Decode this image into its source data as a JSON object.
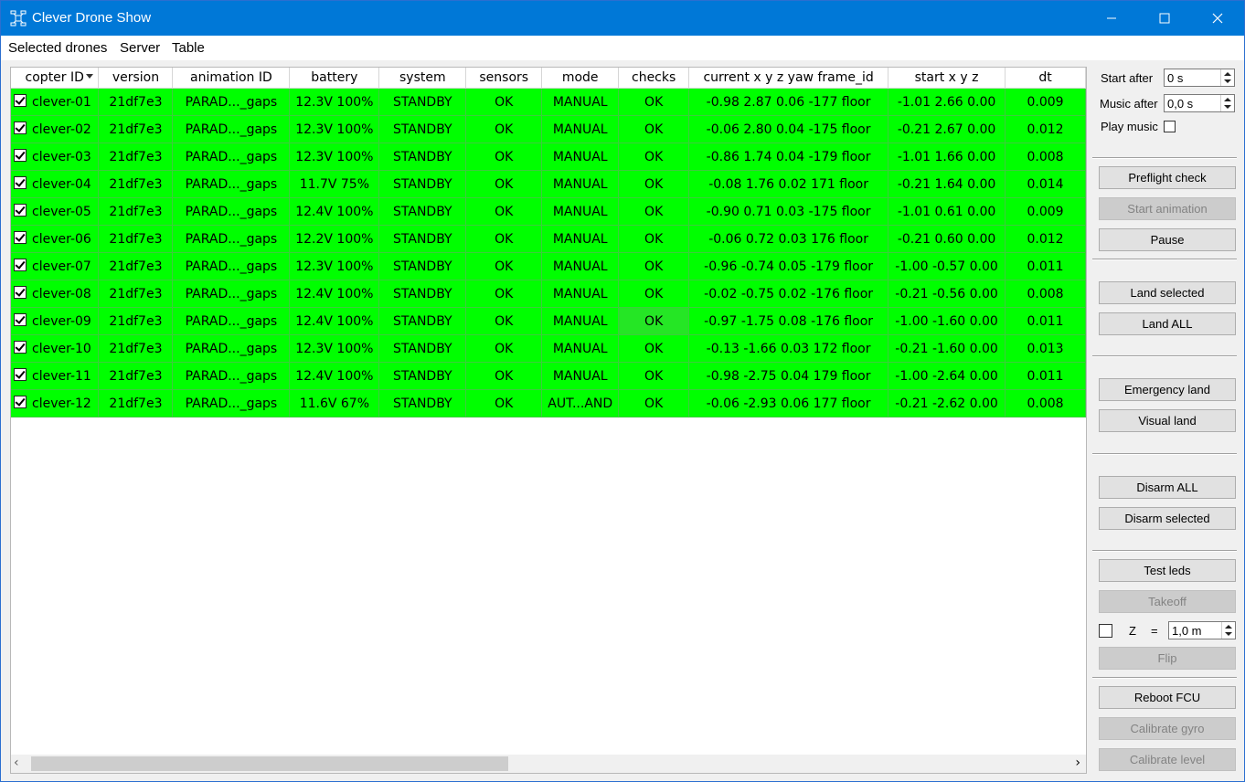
{
  "window": {
    "title": "Clever Drone Show",
    "minimize_icon": "minimize-icon",
    "maximize_icon": "maximize-icon",
    "close_icon": "close-icon"
  },
  "menu": {
    "items": [
      "Selected drones",
      "Server",
      "Table"
    ]
  },
  "table": {
    "columns": [
      "copter ID",
      "version",
      "animation ID",
      "battery",
      "system",
      "sensors",
      "mode",
      "checks",
      "current x y z yaw frame_id",
      "start x y z",
      "dt"
    ],
    "sort_column": "copter ID",
    "row_color": "#00ff00",
    "rows": [
      {
        "checked": true,
        "id": "clever-01",
        "version": "21df7e3",
        "animation": "PARAD..._gaps",
        "battery": "12.3V 100%",
        "system": "STANDBY",
        "sensors": "OK",
        "mode": "MANUAL",
        "checks": "OK",
        "current": "-0.98 2.87 0.06 -177 floor",
        "start": "-1.01 2.66 0.00",
        "dt": "0.009"
      },
      {
        "checked": true,
        "id": "clever-02",
        "version": "21df7e3",
        "animation": "PARAD..._gaps",
        "battery": "12.3V 100%",
        "system": "STANDBY",
        "sensors": "OK",
        "mode": "MANUAL",
        "checks": "OK",
        "current": "-0.06 2.80 0.04 -175 floor",
        "start": "-0.21 2.67 0.00",
        "dt": "0.012"
      },
      {
        "checked": true,
        "id": "clever-03",
        "version": "21df7e3",
        "animation": "PARAD..._gaps",
        "battery": "12.3V 100%",
        "system": "STANDBY",
        "sensors": "OK",
        "mode": "MANUAL",
        "checks": "OK",
        "current": "-0.86 1.74 0.04 -179 floor",
        "start": "-1.01 1.66 0.00",
        "dt": "0.008"
      },
      {
        "checked": true,
        "id": "clever-04",
        "version": "21df7e3",
        "animation": "PARAD..._gaps",
        "battery": "11.7V 75%",
        "system": "STANDBY",
        "sensors": "OK",
        "mode": "MANUAL",
        "checks": "OK",
        "current": "-0.08 1.76 0.02 171 floor",
        "start": "-0.21 1.64 0.00",
        "dt": "0.014"
      },
      {
        "checked": true,
        "id": "clever-05",
        "version": "21df7e3",
        "animation": "PARAD..._gaps",
        "battery": "12.4V 100%",
        "system": "STANDBY",
        "sensors": "OK",
        "mode": "MANUAL",
        "checks": "OK",
        "current": "-0.90 0.71 0.03 -175 floor",
        "start": "-1.01 0.61 0.00",
        "dt": "0.009"
      },
      {
        "checked": true,
        "id": "clever-06",
        "version": "21df7e3",
        "animation": "PARAD..._gaps",
        "battery": "12.2V 100%",
        "system": "STANDBY",
        "sensors": "OK",
        "mode": "MANUAL",
        "checks": "OK",
        "current": "-0.06 0.72 0.03 176 floor",
        "start": "-0.21 0.60 0.00",
        "dt": "0.012"
      },
      {
        "checked": true,
        "id": "clever-07",
        "version": "21df7e3",
        "animation": "PARAD..._gaps",
        "battery": "12.3V 100%",
        "system": "STANDBY",
        "sensors": "OK",
        "mode": "MANUAL",
        "checks": "OK",
        "current": "-0.96 -0.74 0.05 -179 floor",
        "start": "-1.00 -0.57 0.00",
        "dt": "0.011"
      },
      {
        "checked": true,
        "id": "clever-08",
        "version": "21df7e3",
        "animation": "PARAD..._gaps",
        "battery": "12.4V 100%",
        "system": "STANDBY",
        "sensors": "OK",
        "mode": "MANUAL",
        "checks": "OK",
        "current": "-0.02 -0.75 0.02 -176 floor",
        "start": "-0.21 -0.56 0.00",
        "dt": "0.008"
      },
      {
        "checked": true,
        "id": "clever-09",
        "version": "21df7e3",
        "animation": "PARAD..._gaps",
        "battery": "12.4V 100%",
        "system": "STANDBY",
        "sensors": "OK",
        "mode": "MANUAL",
        "checks": "OK",
        "current": "-0.97 -1.75 0.08 -176 floor",
        "start": "-1.00 -1.60 0.00",
        "dt": "0.011",
        "selected_cell": "checks"
      },
      {
        "checked": true,
        "id": "clever-10",
        "version": "21df7e3",
        "animation": "PARAD..._gaps",
        "battery": "12.3V 100%",
        "system": "STANDBY",
        "sensors": "OK",
        "mode": "MANUAL",
        "checks": "OK",
        "current": "-0.13 -1.66 0.03 172 floor",
        "start": "-0.21 -1.60 0.00",
        "dt": "0.013"
      },
      {
        "checked": true,
        "id": "clever-11",
        "version": "21df7e3",
        "animation": "PARAD..._gaps",
        "battery": "12.4V 100%",
        "system": "STANDBY",
        "sensors": "OK",
        "mode": "MANUAL",
        "checks": "OK",
        "current": "-0.98 -2.75 0.04 179 floor",
        "start": "-1.00 -2.64 0.00",
        "dt": "0.011"
      },
      {
        "checked": true,
        "id": "clever-12",
        "version": "21df7e3",
        "animation": "PARAD..._gaps",
        "battery": "11.6V 67%",
        "system": "STANDBY",
        "sensors": "OK",
        "mode": "AUT...AND",
        "checks": "OK",
        "current": "-0.06 -2.93 0.06 177 floor",
        "start": "-0.21 -2.62 0.00",
        "dt": "0.008"
      }
    ]
  },
  "panel": {
    "start_after_label": "Start after",
    "start_after_value": "0 s",
    "music_after_label": "Music after",
    "music_after_value": "0,0 s",
    "play_music_label": "Play music",
    "play_music_checked": false,
    "buttons": {
      "preflight": "Preflight check",
      "start_animation": "Start animation",
      "pause": "Pause",
      "land_selected": "Land selected",
      "land_all": "Land ALL",
      "emergency_land": "Emergency land",
      "visual_land": "Visual land",
      "disarm_all": "Disarm ALL",
      "disarm_selected": "Disarm selected",
      "test_leds": "Test leds",
      "takeoff": "Takeoff",
      "flip": "Flip",
      "reboot_fcu": "Reboot FCU",
      "calibrate_gyro": "Calibrate gyro",
      "calibrate_level": "Calibrate level"
    },
    "z_label": "Z",
    "z_equals": "=",
    "z_value": "1,0 m",
    "z_checked": false
  }
}
